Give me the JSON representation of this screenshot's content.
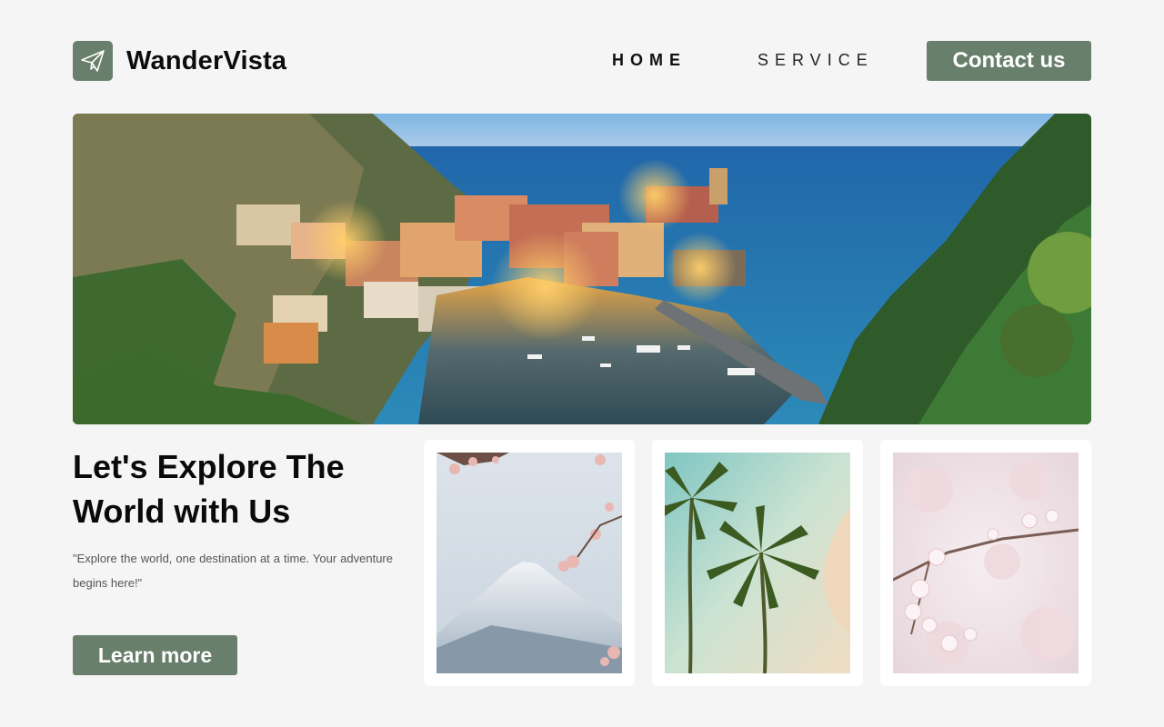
{
  "header": {
    "brand": "WanderVista",
    "nav": [
      {
        "label": "HOME",
        "active": true
      },
      {
        "label": "SERVICE",
        "active": false
      }
    ],
    "contact_label": "Contact us"
  },
  "hero": {
    "image": "coastal-village-sunset"
  },
  "intro": {
    "headline_line1": "Let's Explore The",
    "headline_line2": "World with Us",
    "tagline": "\"Explore the world, one destination at a time. Your adventure begins here!\"",
    "cta_label": "Learn more"
  },
  "gallery": [
    {
      "image": "mount-fuji-cherry-blossom"
    },
    {
      "image": "palm-trees-beach"
    },
    {
      "image": "cherry-blossom-branch"
    }
  ],
  "colors": {
    "accent": "#687f6b",
    "background": "#f5f5f5"
  }
}
